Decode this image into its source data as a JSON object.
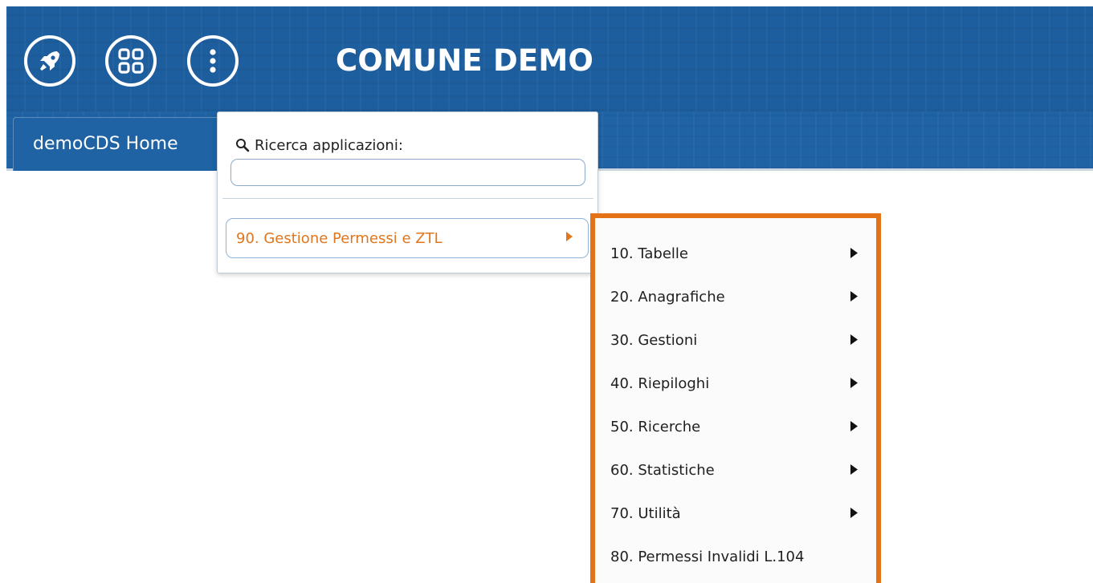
{
  "header": {
    "title": "COMUNE DEMO",
    "buttons": [
      {
        "name": "launch-button",
        "icon": "rocket-icon"
      },
      {
        "name": "apps-button",
        "icon": "grid-icon"
      },
      {
        "name": "more-button",
        "icon": "vertical-dots-icon"
      }
    ]
  },
  "tabs": [
    {
      "label": "demoCDS Home"
    }
  ],
  "app_search": {
    "label": "Ricerca applicazioni:",
    "value": "",
    "placeholder": ""
  },
  "app_entry": {
    "label": "90. Gestione Permessi e ZTL"
  },
  "submenu": {
    "items": [
      {
        "label": "10. Tabelle",
        "has_children": true
      },
      {
        "label": "20. Anagrafiche",
        "has_children": true
      },
      {
        "label": "30. Gestioni",
        "has_children": true
      },
      {
        "label": "40. Riepiloghi",
        "has_children": true
      },
      {
        "label": "50. Ricerche",
        "has_children": true
      },
      {
        "label": "60. Statistiche",
        "has_children": true
      },
      {
        "label": "70. Utilità",
        "has_children": true
      },
      {
        "label": "80. Permessi Invalidi L.104",
        "has_children": false
      }
    ]
  },
  "colors": {
    "header_blue": "#1d5e9e",
    "highlight_orange": "#e37316",
    "entry_orange": "#e0761d"
  }
}
